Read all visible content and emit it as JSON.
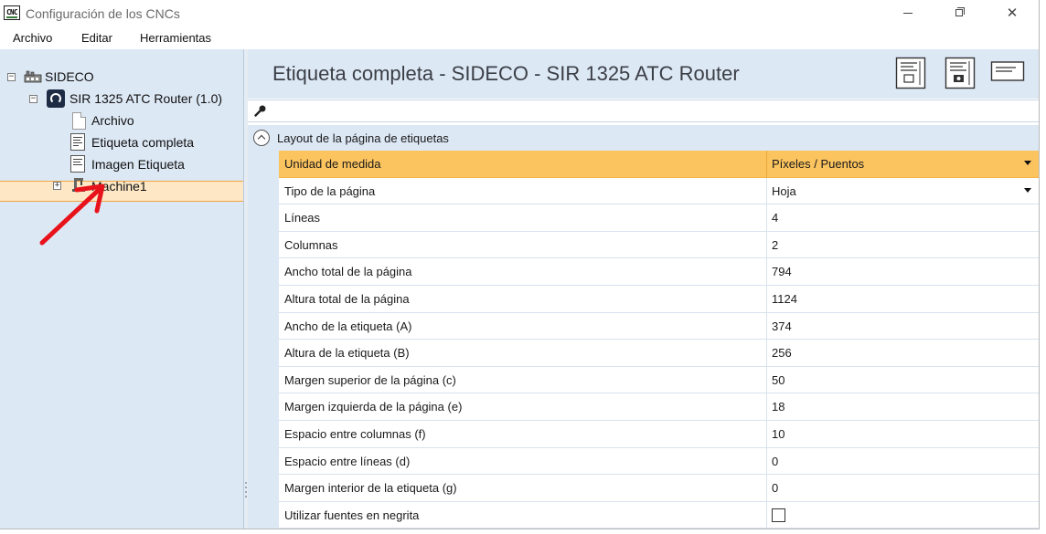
{
  "window": {
    "app_icon_text": "CNC",
    "title": "Configuración de los CNCs"
  },
  "menu": {
    "items": [
      "Archivo",
      "Editar",
      "Herramientas"
    ]
  },
  "tree": {
    "root": "SIDECO",
    "machine": "SIR 1325 ATC Router (1.0)",
    "children": [
      "Archivo",
      "Etiqueta completa",
      "Imagen Etiqueta",
      "Machine1"
    ],
    "selected": "Etiqueta completa"
  },
  "content": {
    "title": "Etiqueta completa - SIDECO - SIR 1325 ATC Router",
    "search_placeholder": "",
    "section_title": "Layout de la página de etiquetas",
    "properties": [
      {
        "name": "Unidad de medida",
        "value": "Píxeles / Puentos",
        "type": "dropdown"
      },
      {
        "name": "Tipo de la página",
        "value": "Hoja",
        "type": "dropdown"
      },
      {
        "name": "Líneas",
        "value": "4",
        "type": "text"
      },
      {
        "name": "Columnas",
        "value": "2",
        "type": "text"
      },
      {
        "name": "Ancho total de la página",
        "value": "794",
        "type": "text"
      },
      {
        "name": "Altura total de la página",
        "value": "1124",
        "type": "text"
      },
      {
        "name": "Ancho de la etiqueta (A)",
        "value": "374",
        "type": "text"
      },
      {
        "name": "Altura de la etiqueta (B)",
        "value": "256",
        "type": "text"
      },
      {
        "name": "Margen superior de la página (c)",
        "value": "50",
        "type": "text"
      },
      {
        "name": "Margen izquierda de la página (e)",
        "value": "18",
        "type": "text"
      },
      {
        "name": "Espacio entre columnas (f)",
        "value": "10",
        "type": "text"
      },
      {
        "name": "Espacio entre líneas (d)",
        "value": "0",
        "type": "text"
      },
      {
        "name": "Margen interior de la etiqueta (g)",
        "value": "0",
        "type": "text"
      },
      {
        "name": "Utilizar fuentes en negrita",
        "value": false,
        "type": "checkbox"
      }
    ],
    "selected_property": "Unidad de medida"
  },
  "colors": {
    "panel_bg": "#dde8f5",
    "selection_orange": "#fcc45f",
    "tree_selection": "#fde7c4",
    "annotation_arrow": "#e8121b"
  },
  "icons": [
    "app-icon",
    "minimize-icon",
    "maximize-icon",
    "close-icon",
    "factory-icon",
    "router-icon",
    "document-icon",
    "label-document-icon",
    "machine-icon",
    "search-icon",
    "collapse-icon",
    "chevron-down-icon",
    "checkbox"
  ]
}
